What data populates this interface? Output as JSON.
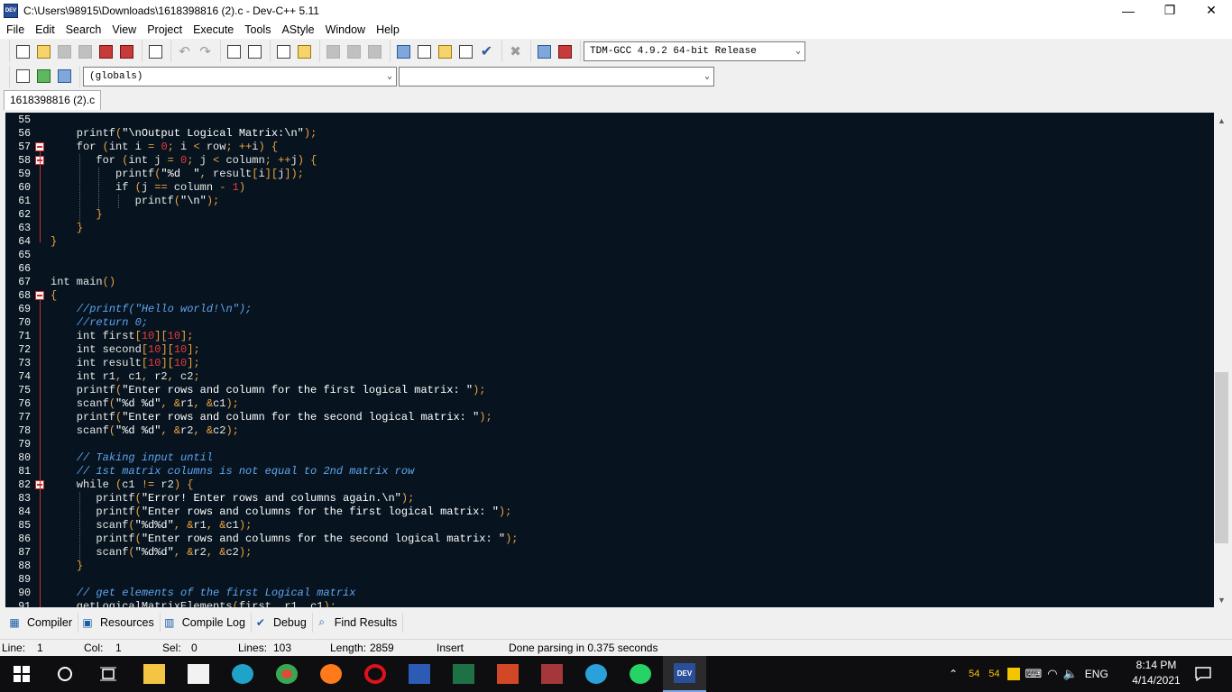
{
  "window": {
    "title": "C:\\Users\\98915\\Downloads\\1618398816 (2).c - Dev-C++ 5.11",
    "app_icon_text": "DEV",
    "controls": {
      "minimize": "—",
      "maximize": "❐",
      "close": "✕"
    }
  },
  "menu": [
    "File",
    "Edit",
    "Search",
    "View",
    "Project",
    "Execute",
    "Tools",
    "AStyle",
    "Window",
    "Help"
  ],
  "toolbar": {
    "compiler_select": "TDM-GCC 4.9.2 64-bit Release",
    "scope_select": "(globals)",
    "function_select": ""
  },
  "file_tab": "1618398816 (2).c",
  "editor": {
    "lines": [
      {
        "n": "55",
        "fold": false,
        "text": ""
      },
      {
        "n": "56",
        "fold": false,
        "text": "    printf(\"\\nOutput Logical Matrix:\\n\");"
      },
      {
        "n": "57",
        "fold": true,
        "text": "    for (int i = 0; i < row; ++i) {"
      },
      {
        "n": "58",
        "fold": true,
        "text": "       for (int j = 0; j < column; ++j) {"
      },
      {
        "n": "59",
        "fold": false,
        "text": "          printf(\"%d  \", result[i][j]);"
      },
      {
        "n": "60",
        "fold": false,
        "text": "          if (j == column - 1)"
      },
      {
        "n": "61",
        "fold": false,
        "text": "             printf(\"\\n\");"
      },
      {
        "n": "62",
        "fold": false,
        "text": "       }"
      },
      {
        "n": "63",
        "fold": false,
        "text": "    }"
      },
      {
        "n": "64",
        "fold": false,
        "text": "}"
      },
      {
        "n": "65",
        "fold": false,
        "text": ""
      },
      {
        "n": "66",
        "fold": false,
        "text": ""
      },
      {
        "n": "67",
        "fold": false,
        "text": "int main()"
      },
      {
        "n": "68",
        "fold": true,
        "text": "{"
      },
      {
        "n": "69",
        "fold": false,
        "text": "    //printf(\"Hello world!\\n\");"
      },
      {
        "n": "70",
        "fold": false,
        "text": "    //return 0;"
      },
      {
        "n": "71",
        "fold": false,
        "text": "    int first[10][10];"
      },
      {
        "n": "72",
        "fold": false,
        "text": "    int second[10][10];"
      },
      {
        "n": "73",
        "fold": false,
        "text": "    int result[10][10];"
      },
      {
        "n": "74",
        "fold": false,
        "text": "    int r1, c1, r2, c2;"
      },
      {
        "n": "75",
        "fold": false,
        "text": "    printf(\"Enter rows and column for the first logical matrix: \");"
      },
      {
        "n": "76",
        "fold": false,
        "text": "    scanf(\"%d %d\", &r1, &c1);"
      },
      {
        "n": "77",
        "fold": false,
        "text": "    printf(\"Enter rows and column for the second logical matrix: \");"
      },
      {
        "n": "78",
        "fold": false,
        "text": "    scanf(\"%d %d\", &r2, &c2);"
      },
      {
        "n": "79",
        "fold": false,
        "text": ""
      },
      {
        "n": "80",
        "fold": false,
        "text": "    // Taking input until"
      },
      {
        "n": "81",
        "fold": false,
        "text": "    // 1st matrix columns is not equal to 2nd matrix row"
      },
      {
        "n": "82",
        "fold": true,
        "text": "    while (c1 != r2) {"
      },
      {
        "n": "83",
        "fold": false,
        "text": "       printf(\"Error! Enter rows and columns again.\\n\");"
      },
      {
        "n": "84",
        "fold": false,
        "text": "       printf(\"Enter rows and columns for the first logical matrix: \");"
      },
      {
        "n": "85",
        "fold": false,
        "text": "       scanf(\"%d%d\", &r1, &c1);"
      },
      {
        "n": "86",
        "fold": false,
        "text": "       printf(\"Enter rows and columns for the second logical matrix: \");"
      },
      {
        "n": "87",
        "fold": false,
        "text": "       scanf(\"%d%d\", &r2, &c2);"
      },
      {
        "n": "88",
        "fold": false,
        "text": "    }"
      },
      {
        "n": "89",
        "fold": false,
        "text": ""
      },
      {
        "n": "90",
        "fold": false,
        "text": "    // get elements of the first Logical matrix"
      },
      {
        "n": "91",
        "fold": false,
        "text": "    getLogicalMatrixElements(first, r1, c1);"
      }
    ]
  },
  "panel_tabs": [
    {
      "label": "Compiler",
      "icon": "compiler-icon"
    },
    {
      "label": "Resources",
      "icon": "resources-icon"
    },
    {
      "label": "Compile Log",
      "icon": "compile-log-icon"
    },
    {
      "label": "Debug",
      "icon": "debug-check-icon"
    },
    {
      "label": "Find Results",
      "icon": "find-results-icon"
    }
  ],
  "status": {
    "line_label": "Line:",
    "line_value": "1",
    "col_label": "Col:",
    "col_value": "1",
    "sel_label": "Sel:",
    "sel_value": "0",
    "lines_label": "Lines:",
    "lines_value": "103",
    "length_label": "Length:",
    "length_value": "2859",
    "mode": "Insert",
    "message": "Done parsing in 0.375 seconds"
  },
  "taskbar": {
    "tray_nums": [
      "54",
      "54"
    ],
    "language": "ENG",
    "time": "8:14 PM",
    "date": "4/14/2021"
  }
}
